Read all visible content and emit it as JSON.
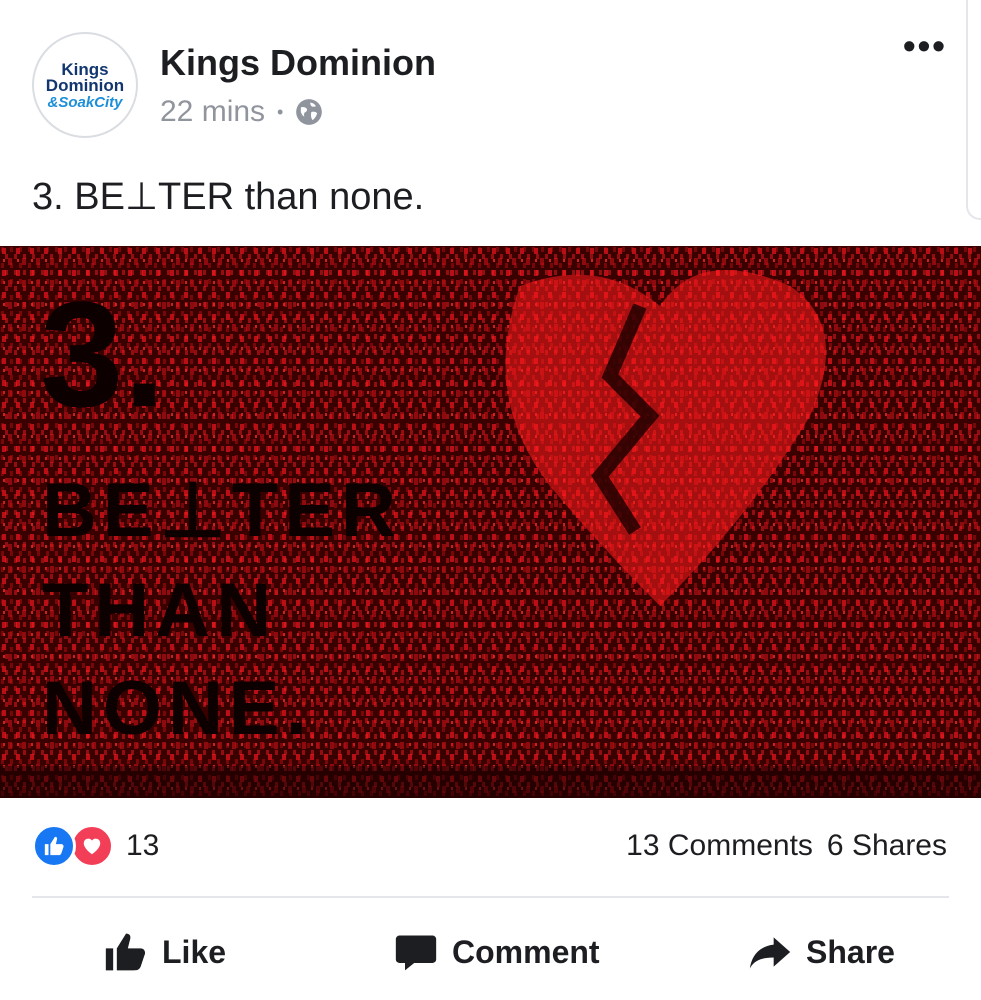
{
  "post": {
    "page_name": "Kings Dominion",
    "avatar_lines": [
      "Kings",
      "Dominion",
      "&SoakCity"
    ],
    "time": "22 mins",
    "separator": "•",
    "privacy_icon": "globe-icon",
    "more_label": "•••",
    "text": "3. BE⊥TER than none."
  },
  "image": {
    "lines": [
      "3.",
      "BE⊥TER",
      "THAN",
      "NONE."
    ],
    "colors": {
      "background": "#3a0000",
      "code_rain": "#d3131b",
      "text": "#0c0000"
    }
  },
  "engagement": {
    "reaction_icons": [
      "like-icon",
      "love-icon"
    ],
    "reaction_count": "13",
    "comments": "13 Comments",
    "shares": "6 Shares"
  },
  "actions": {
    "like": "Like",
    "comment": "Comment",
    "share": "Share"
  },
  "colors": {
    "like_blue": "#1877f2",
    "love_red": "#f33e58",
    "meta_gray": "#90949c"
  }
}
